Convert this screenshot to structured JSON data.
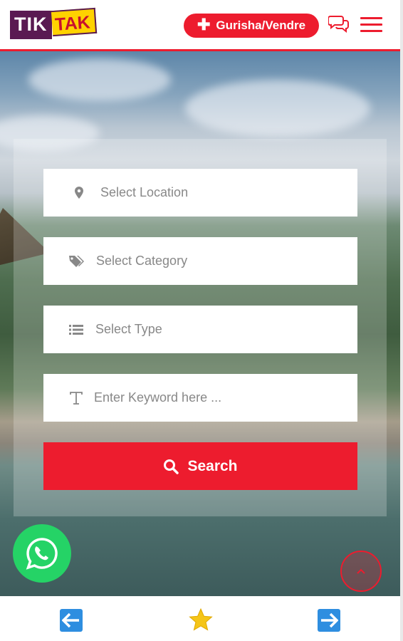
{
  "header": {
    "logo_part1": "TIK",
    "logo_part2": "TAK",
    "post_button_label": "Gurisha/Vendre",
    "post_button_icon": "plus-icon",
    "chat_icon": "chat-bubbles-icon",
    "menu_icon": "hamburger-menu-icon"
  },
  "search_form": {
    "location_placeholder": "Select Location",
    "category_placeholder": "Select Category",
    "type_placeholder": "Select Type",
    "keyword_placeholder": "Enter Keyword here ...",
    "search_button_label": "Search"
  },
  "floating": {
    "whatsapp_icon": "whatsapp-icon",
    "scroll_top_icon": "chevron-up-icon"
  },
  "bottom_nav": {
    "back_icon": "arrow-left-icon",
    "favorites_icon": "star-icon",
    "forward_icon": "arrow-right-icon"
  },
  "colors": {
    "brand_red": "#ed1c2e",
    "logo_purple": "#5a1a52",
    "logo_yellow": "#ffd200",
    "whatsapp_green": "#25d366",
    "nav_blue": "#2e8ee0",
    "star_yellow": "#f5c518"
  }
}
